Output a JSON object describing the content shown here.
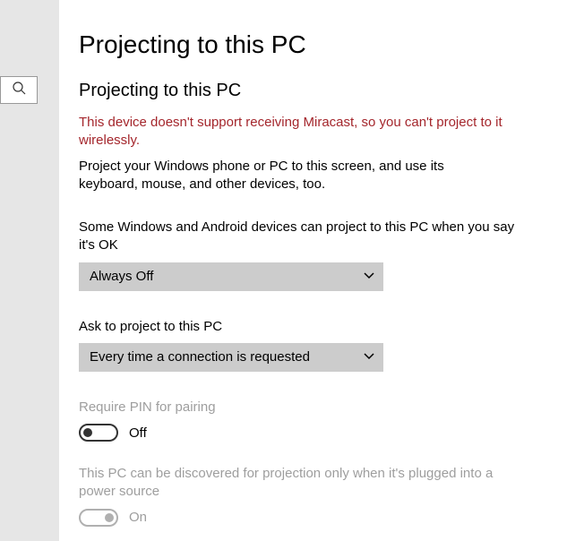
{
  "pageTitle": "Projecting to this PC",
  "section": {
    "heading": "Projecting to this PC",
    "errorText": "This device doesn't support receiving Miracast, so you can't project to it wirelessly.",
    "introText": "Project your Windows phone or PC to this screen, and use its keyboard, mouse, and other devices, too."
  },
  "settings": {
    "availability": {
      "label": "Some Windows and Android devices can project to this PC when you say it's OK",
      "value": "Always Off"
    },
    "ask": {
      "label": "Ask to project to this PC",
      "value": "Every time a connection is requested"
    },
    "requirePin": {
      "label": "Require PIN for pairing",
      "stateText": "Off"
    },
    "discoverPlugged": {
      "label": "This PC can be discovered for projection only when it's plugged into a power source",
      "stateText": "On"
    }
  }
}
